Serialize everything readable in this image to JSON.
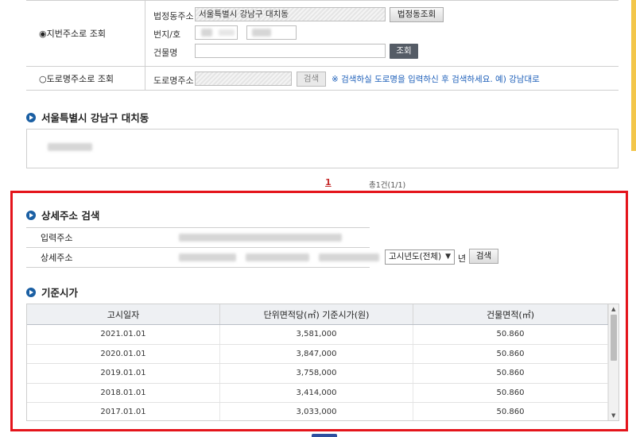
{
  "search_form": {
    "jibun_option_label": "◉지번주소로 조회",
    "road_option_label": "○도로명주소로 조회",
    "legal_dong_label": "법정동주소",
    "legal_dong_value": "서울특별시 강남구 대치동",
    "legal_dong_button": "법정동조회",
    "lot_label": "번지/호",
    "building_label": "건물명",
    "lookup_button": "조회",
    "road_label": "도로명주소",
    "road_search_button": "검색",
    "road_hint": "※ 검색하실 도로명을 입력하신 후 검색하세요. 예) 강남대로"
  },
  "result_section": {
    "title": "서울특별시 강남구 대치동"
  },
  "pagination": {
    "current": "1",
    "total": "총1건(1/1)"
  },
  "detail_section": {
    "title": "상세주소 검색",
    "input_address_label": "입력주소",
    "detail_address_label": "상세주소",
    "year_select_value": "고시년도(전체)",
    "year_suffix": "년",
    "search_button": "검색"
  },
  "price_section": {
    "title": "기준시가",
    "columns": [
      "고시일자",
      "단위면적당(㎡) 기준시가(원)",
      "건물면적(㎡)"
    ],
    "rows": [
      [
        "2021.01.01",
        "3,581,000",
        "50.860"
      ],
      [
        "2020.01.01",
        "3,847,000",
        "50.860"
      ],
      [
        "2019.01.01",
        "3,758,000",
        "50.860"
      ],
      [
        "2018.01.01",
        "3,414,000",
        "50.860"
      ],
      [
        "2017.01.01",
        "3,033,000",
        "50.860"
      ]
    ]
  },
  "colors": {
    "highlight_frame": "#e4141b",
    "accent_blue": "#1a5fa3",
    "dark_button": "#555c66"
  },
  "icons": [
    "section-bullet-icon",
    "chevron-down-icon",
    "scroll-up-arrow-icon",
    "scroll-down-arrow-icon"
  ]
}
